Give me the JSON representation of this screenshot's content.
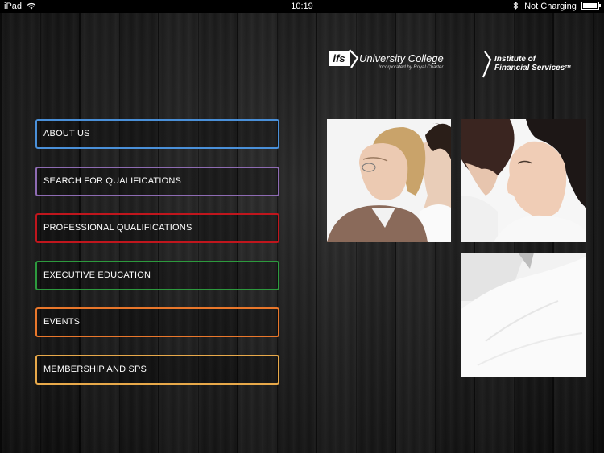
{
  "status_bar": {
    "device": "iPad",
    "time": "10:19",
    "battery_status": "Not Charging"
  },
  "logos": {
    "ifs_abbrev": "ifs",
    "ifs_name": "University College",
    "ifs_subtitle": "Incorporated by Royal Charter",
    "institute_line1": "Institute of",
    "institute_line2": "Financial Services",
    "trademark": "TM"
  },
  "menu": {
    "items": [
      {
        "label": "ABOUT US",
        "color": "#4a90d9"
      },
      {
        "label": "SEARCH FOR QUALIFICATIONS",
        "color": "#8e6bb3"
      },
      {
        "label": "PROFESSIONAL QUALIFICATIONS",
        "color": "#c0161d"
      },
      {
        "label": "EXECUTIVE EDUCATION",
        "color": "#2d9a3e"
      },
      {
        "label": "EVENTS",
        "color": "#e9772b"
      },
      {
        "label": "MEMBERSHIP AND SPS",
        "color": "#e8a94a"
      }
    ]
  },
  "icons": [
    "wifi-icon",
    "bluetooth-icon",
    "battery-icon"
  ]
}
